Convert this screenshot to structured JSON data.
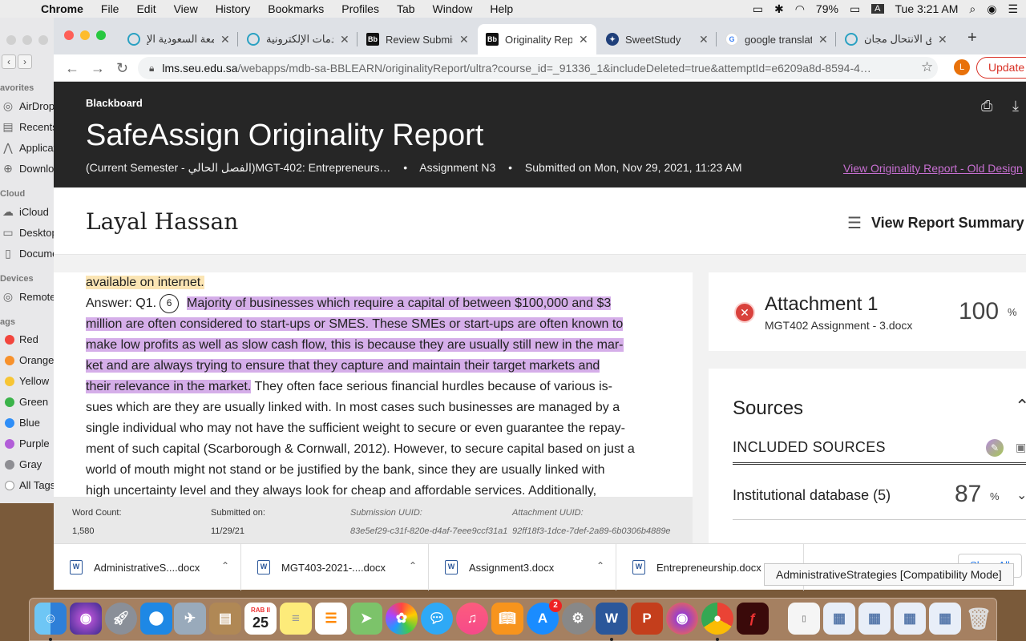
{
  "menubar": {
    "app": "Chrome",
    "items": [
      "File",
      "Edit",
      "View",
      "History",
      "Bookmarks",
      "Profiles",
      "Tab",
      "Window",
      "Help"
    ],
    "battery": "79%",
    "input_letter": "A",
    "clock": "Tue 3:21 AM"
  },
  "finder": {
    "favorites_label": "avorites",
    "favorites": [
      "AirDrop",
      "Recents",
      "Applications",
      "Downloads"
    ],
    "cloud_label": "Cloud",
    "cloud": [
      "iCloud",
      "Desktop",
      "Documents"
    ],
    "devices_label": "Devices",
    "devices": [
      "Remote"
    ],
    "tags_label": "ags",
    "tags": [
      {
        "name": "Red",
        "color": "#f2453d"
      },
      {
        "name": "Orange",
        "color": "#f7912b"
      },
      {
        "name": "Yellow",
        "color": "#f7c534"
      },
      {
        "name": "Green",
        "color": "#3bb34a"
      },
      {
        "name": "Blue",
        "color": "#2f8ef7"
      },
      {
        "name": "Purple",
        "color": "#b25ed8"
      },
      {
        "name": "Gray",
        "color": "#8e8e93"
      },
      {
        "name": "All Tags",
        "color": "#ffffff"
      }
    ]
  },
  "tabs": [
    {
      "label": "الجامعة السعودية الإ",
      "icon": "seu-icon",
      "color": "#2aa1c2"
    },
    {
      "label": "الخدمات الإلكترونية -",
      "icon": "seu-icon",
      "color": "#2aa1c2"
    },
    {
      "label": "Review Submis",
      "icon": "blackboard-icon",
      "color": "#111111"
    },
    {
      "label": "Originality Rep",
      "icon": "blackboard-icon",
      "color": "#111111"
    },
    {
      "label": "SweetStudy",
      "icon": "sweetstudy-icon",
      "color": "#1f3f7a"
    },
    {
      "label": "google translat",
      "icon": "google-icon",
      "color": "#4285f4"
    },
    {
      "label": "مدقق الانتحال مجان",
      "icon": "search-icon",
      "color": "#2aa1c2"
    }
  ],
  "address": {
    "domain": "lms.seu.edu.sa",
    "path": "/webapps/mdb-sa-BBLEARN/originalityReport/ultra?course_id=_91336_1&includeDeleted=true&attemptId=e6209a8d-8594-4…",
    "profile_letter": "L",
    "update_label": "Update"
  },
  "report": {
    "brand": "Blackboard",
    "title": "SafeAssign Originality Report",
    "course": "(Current Semester - الفصل الحالي)MGT-402: Entrepreneurs…",
    "assignment": "Assignment N3",
    "submitted": "Submitted on Mon, Nov 29, 2021, 11:23 AM",
    "old_design_link": "View Originality Report - Old Design",
    "separator": "•"
  },
  "student": {
    "name": "Layal Hassan",
    "summary_label": "View Report Summary"
  },
  "document": {
    "line0": "available on internet.",
    "answer_prefix": "Answer: Q1.",
    "match_number": "6",
    "highlight_lines": [
      "Majority of businesses which require a capital of between $100,000 and $3",
      "million are often considered to start-ups or SMES. These SMEs or start-ups are often known to",
      "make low profits as well as slow cash flow, this is because they are usually still new in the mar-",
      "ket and are always trying to ensure that they capture and maintain their target markets and",
      "their relevance in the market."
    ],
    "tail_on_highlight": " They often face serious financial hurdles because of various is-",
    "plain_lines": [
      "sues which are they are usually linked with. In most cases such businesses are managed by a",
      "single individual who may not have the sufficient weight to secure or even guarantee the repay-",
      "ment of such capital (Scarborough & Cornwall, 2012). However, to secure capital based on just a",
      "world of mouth might not stand or be justified by the bank, since they are usually linked with",
      "high uncertainty level and they always look for cheap and affordable services. Additionally,"
    ]
  },
  "footer": {
    "word_count_label": "Word Count:",
    "word_count": "1,580",
    "submitted_label": "Submitted on:",
    "submitted": "11/29/21",
    "submission_uuid_label": "Submission UUID:",
    "submission_uuid": "83e5ef29-c31f-820e-d4af-7eee9ccf31a1",
    "attachment_uuid_label": "Attachment UUID:",
    "attachment_uuid": "92ff18f3-1dce-7def-2a89-6b0306b4889e"
  },
  "attachment": {
    "title": "Attachment 1",
    "file": "MGT402 Assignment - 3.docx",
    "percent": "100",
    "percent_sign": "%"
  },
  "sources": {
    "heading": "Sources",
    "included_label": "INCLUDED SOURCES",
    "db_label": "Institutional database (5)",
    "db_percent": "87",
    "percent_sign": "%"
  },
  "downloads": [
    {
      "name": "AdministrativeS....docx"
    },
    {
      "name": "MGT403-2021-....docx"
    },
    {
      "name": "Assignment3.docx"
    },
    {
      "name": "Entrepreneurship.docx"
    }
  ],
  "show_all": "Show All",
  "tooltip": "AdministrativeStrategies [Compatibility Mode]",
  "dock": {
    "calendar_month": "RAB II",
    "calendar_day": "25",
    "appstore_badge": "2"
  }
}
